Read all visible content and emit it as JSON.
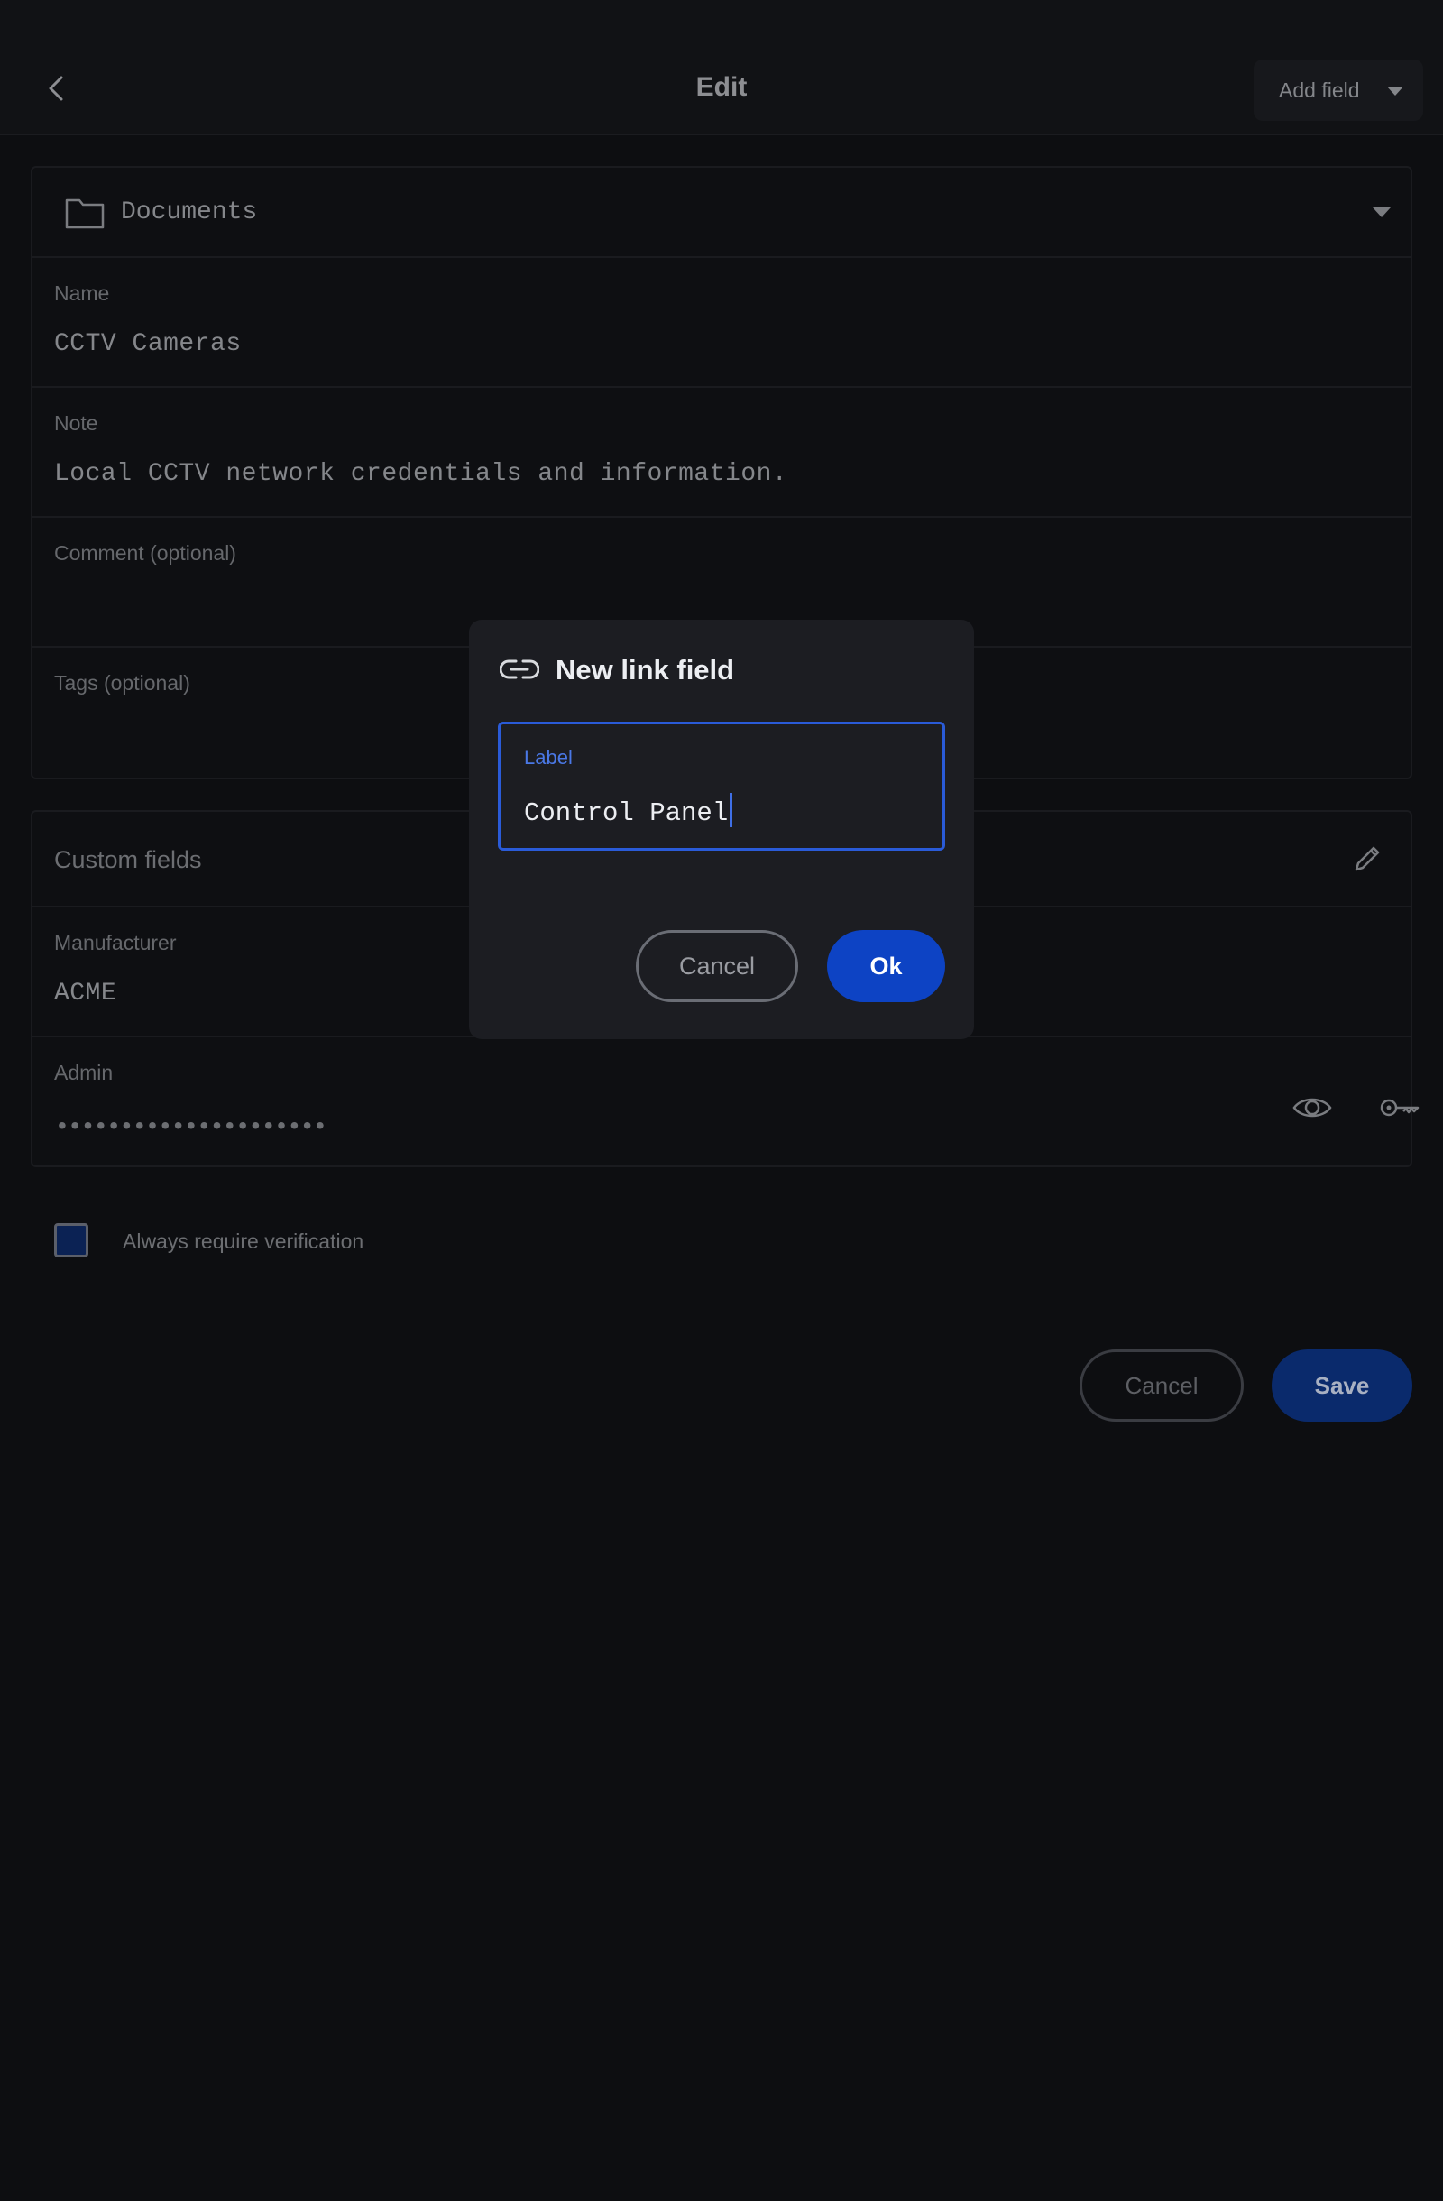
{
  "header": {
    "title": "Edit",
    "add_field_label": "Add field"
  },
  "folder": {
    "name": "Documents"
  },
  "fields": {
    "name": {
      "label": "Name",
      "value": "CCTV Cameras"
    },
    "note": {
      "label": "Note",
      "value": "Local CCTV network credentials and information."
    },
    "comment": {
      "label": "Comment (optional)",
      "value": ""
    },
    "tags": {
      "label": "Tags (optional)",
      "value": ""
    }
  },
  "custom_fields": {
    "title": "Custom fields",
    "manufacturer": {
      "label": "Manufacturer",
      "value": "ACME"
    },
    "admin": {
      "label": "Admin",
      "masked_value": "•••••••••••••••••••••"
    }
  },
  "verification": {
    "label": "Always require verification",
    "checked": true
  },
  "actions": {
    "cancel_label": "Cancel",
    "save_label": "Save"
  },
  "dialog": {
    "title": "New link field",
    "input_label": "Label",
    "input_value": "Control Panel",
    "cancel_label": "Cancel",
    "ok_label": "Ok"
  },
  "colors": {
    "background": "#0d0e11",
    "dialog_background": "#1c1d22",
    "accent": "#2a5bd8",
    "ok_button": "#0d43c4",
    "save_button": "#0a2a6c"
  },
  "icons": [
    "back-arrow-icon",
    "caret-down-icon",
    "folder-icon",
    "pencil-icon",
    "eye-icon",
    "key-icon",
    "link-icon"
  ]
}
